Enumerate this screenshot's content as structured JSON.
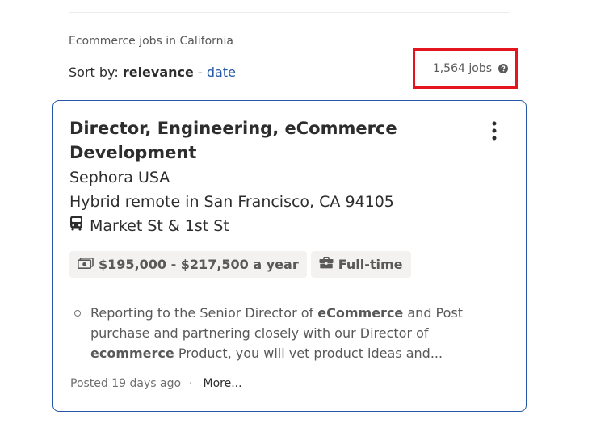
{
  "search": {
    "context": "Ecommerce jobs in California",
    "sort_label": "Sort by:",
    "sort_active": "relevance",
    "sort_separator": "-",
    "sort_option": "date",
    "job_count": "1,564 jobs",
    "job_count_highlight_color": "#e3151f"
  },
  "job": {
    "title": "Director, Engineering, eCommerce Development",
    "company": "Sephora USA",
    "location": "Hybrid remote in San Francisco, CA 94105",
    "transit": "Market St & 1st St",
    "salary": "$195,000 - $217,500 a year",
    "job_type": "Full-time",
    "snippet": {
      "part1": "Reporting to the Senior Director of ",
      "bold1": "eCommerce",
      "part2": " and Post purchase and partnering closely with our Director of ",
      "bold2": "ecommerce",
      "part3": " Product, you will vet product ideas and..."
    },
    "posted": "Posted 19 days ago",
    "footer_dot": "·",
    "more": "More..."
  },
  "icons": {
    "help": "question-circle-icon",
    "menu": "kebab-menu-icon",
    "transit": "bus-icon",
    "salary": "money-icon",
    "job_type": "briefcase-icon"
  },
  "colors": {
    "link": "#2557a7",
    "card_border": "#2557a7",
    "tag_bg": "#f3f2f1"
  }
}
